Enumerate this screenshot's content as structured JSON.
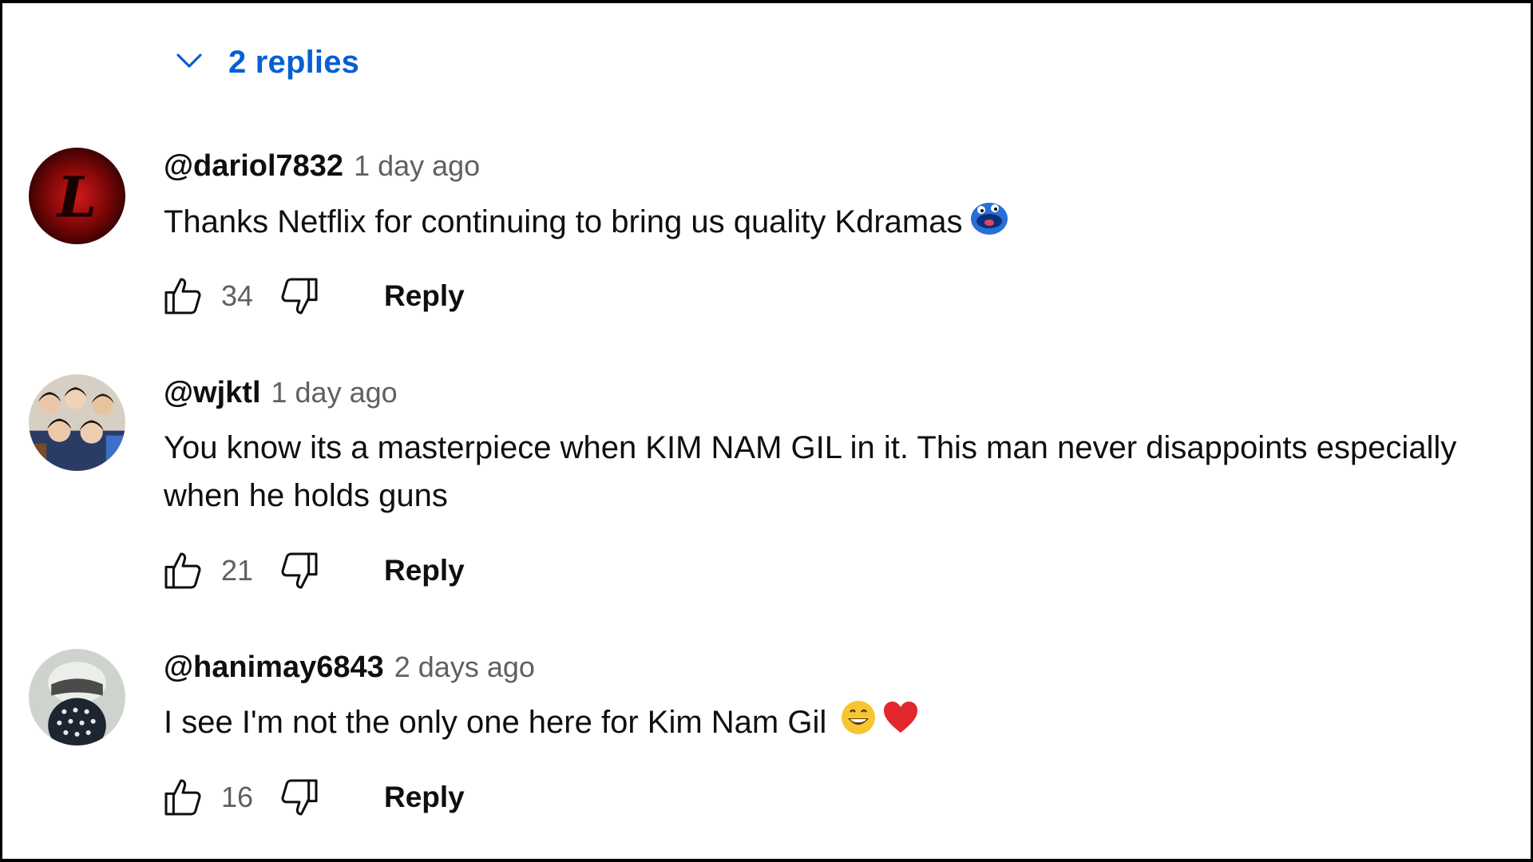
{
  "replies_toggle": {
    "label": "2 replies",
    "icon": "chevron-down-icon"
  },
  "accent_color": "#065fd4",
  "comments": [
    {
      "author": "@dariol7832",
      "time": "1 day ago",
      "text": "Thanks Netflix for continuing to bring us quality Kdramas",
      "emojis": [
        "blue-face-emoji"
      ],
      "likes": "34",
      "reply_label": "Reply"
    },
    {
      "author": "@wjktl",
      "time": "1 day ago",
      "text": "You know its a masterpiece when KIM NAM GIL in it. This man never disappoints especially when he holds guns",
      "emojis": [],
      "likes": "21",
      "reply_label": "Reply"
    },
    {
      "author": "@hanimay6843",
      "time": "2 days ago",
      "text": "I see I'm not the only one here for Kim Nam Gil ",
      "emojis": [
        "grinning-face-emoji",
        "red-heart-emoji"
      ],
      "likes": "16",
      "reply_label": "Reply"
    }
  ]
}
